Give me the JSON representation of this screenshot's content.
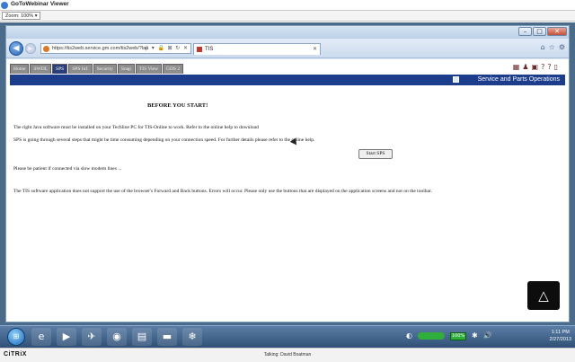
{
  "gotowebinar": {
    "title": "GoToWebinar Viewer",
    "zoom": "Zoom: 100% ▾"
  },
  "browser": {
    "window_buttons": {
      "minimize": "–",
      "maximize": "□",
      "close": "✕"
    },
    "address": "https://tis2web.service.gm.com/tis2web/?lan",
    "address_tools": "ρ ▾ 🔒 ⊠ ↻ ✕",
    "tab_title": "TIS",
    "tab_close": "✕",
    "right_icons": [
      "⌂",
      "☆",
      "⚙"
    ]
  },
  "tis": {
    "tabs": [
      "Home",
      "SWDL",
      "SPS",
      "SPS Inf.",
      "Security",
      "Snap",
      "TIS View",
      "GDS 2"
    ],
    "active_tab_index": 2,
    "tool_icons": [
      "▦",
      "♟",
      "▣",
      "?",
      "?",
      "▯"
    ],
    "header_title": "Service and Parts Operations"
  },
  "content": {
    "heading": "BEFORE YOU START!",
    "para_java": "The right Java software must be installed on your Techline PC for TIS-Online to work. Refer to the online help to download",
    "para_sps": "SPS is going through several steps that might be time consuming depending on your connection speed. For further details please refer to the online help.",
    "para_patient": "Please be patient if connected via slow modem lines ...",
    "para_browser": "The TIS software application does not support the use of the browser's Forward and Back buttons. Errors will occur. Please only use the buttons that are displayed on the application screens and not on the toolbar.",
    "start_button": "Start SPS"
  },
  "citrix_fab_icon": "△",
  "taskbar": {
    "start_label": "⊞",
    "apps": [
      "e",
      "▶",
      "✈",
      "◉",
      "▤",
      "▬",
      "❄"
    ],
    "tray_badge": "100%",
    "tray_icons": [
      "◐",
      "✱",
      "🔊"
    ],
    "clock_time": "1:11 PM",
    "clock_date": "2/27/2013"
  },
  "citrix": {
    "logo": "CiTRiX",
    "talking": "Talking: David Boatman"
  }
}
